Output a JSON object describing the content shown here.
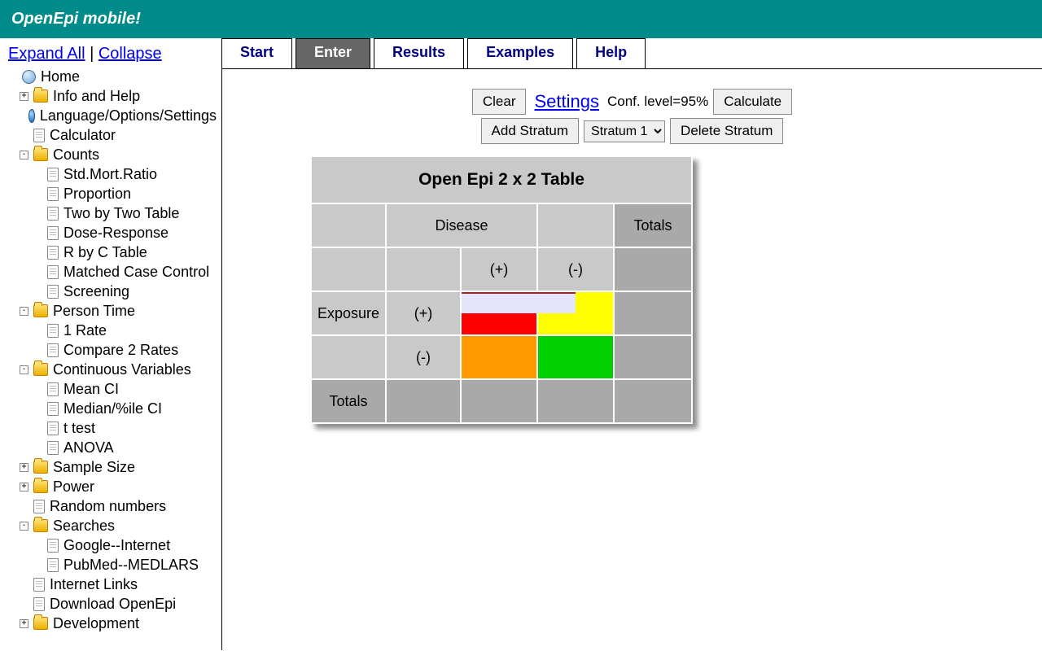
{
  "app_title": "OpenEpi mobile!",
  "sidebar": {
    "expand": "Expand All",
    "collapse": "Collapse",
    "home": "Home",
    "info_help": "Info and Help",
    "lang_opts": "Language/Options/Settings",
    "calculator": "Calculator",
    "counts": "Counts",
    "counts_items": [
      "Std.Mort.Ratio",
      "Proportion",
      "Two by Two Table",
      "Dose-Response",
      "R by C Table",
      "Matched Case Control",
      "Screening"
    ],
    "person_time": "Person Time",
    "person_time_items": [
      "1 Rate",
      "Compare 2 Rates"
    ],
    "cont_vars": "Continuous Variables",
    "cont_vars_items": [
      "Mean CI",
      "Median/%ile CI",
      "t test",
      "ANOVA"
    ],
    "sample_size": "Sample Size",
    "power": "Power",
    "random": "Random numbers",
    "searches": "Searches",
    "searches_items": [
      "Google--Internet",
      "PubMed--MEDLARS"
    ],
    "internet_links": "Internet Links",
    "download": "Download OpenEpi",
    "development": "Development"
  },
  "tabs": [
    "Start",
    "Enter",
    "Results",
    "Examples",
    "Help"
  ],
  "active_tab": 1,
  "toolbar": {
    "clear": "Clear",
    "settings": "Settings",
    "conf": "Conf. level=95%",
    "calculate": "Calculate",
    "add_stratum": "Add Stratum",
    "stratum_selected": "Stratum 1",
    "delete_stratum": "Delete Stratum"
  },
  "table": {
    "title": "Open Epi 2 x 2 Table",
    "disease": "Disease",
    "totals": "Totals",
    "exposure": "Exposure",
    "plus": "(+)",
    "minus": "(-)",
    "totals_row": "Totals"
  }
}
